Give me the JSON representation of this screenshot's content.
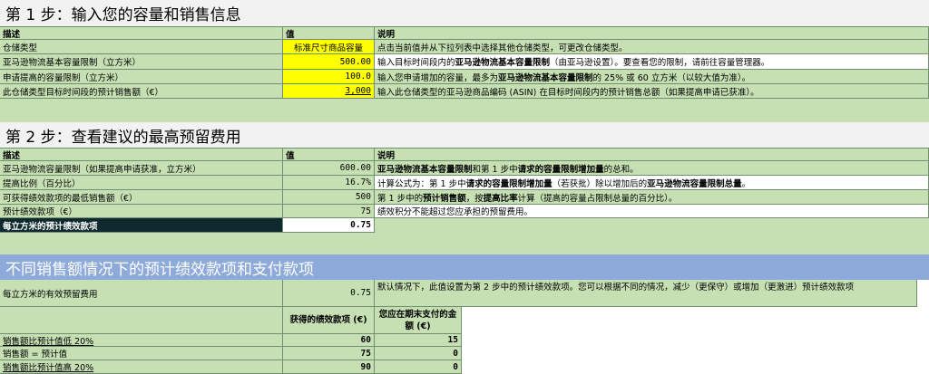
{
  "step1": {
    "title": "第 1 步：输入您的容量和销售信息",
    "headers": {
      "desc": "描述",
      "value": "值",
      "note": "说明"
    },
    "rows": [
      {
        "desc": "仓储类型",
        "value": "标准尺寸商品容量",
        "note": "点击当前值并从下拉列表中选择其他仓储类型，可更改仓储类型。"
      },
      {
        "desc": "亚马逊物流基本容量限制（立方米）",
        "value": "500.00",
        "note_pre": "输入目标时间段内的",
        "note_bold": "亚马逊物流基本容量限制",
        "note_post": "（由亚马逊设置）。要查看您的限制，请前往容量管理器。"
      },
      {
        "desc": "申请提高的容量限制（立方米）",
        "value": "100.0",
        "note_pre": "输入您申请增加的容量，最多为",
        "note_bold": "亚马逊物流基本容量限制",
        "note_post": "的 25% 或 60 立方米（以较大值为准）。"
      },
      {
        "desc": "此仓储类型目标时间段的预计销售额（€）",
        "value": "3,000",
        "note": "输入此仓储类型的亚马逊商品编码 (ASIN) 在目标时间段内的预计销售总额（如果提高申请已获准）。"
      }
    ]
  },
  "step2": {
    "title": "第 2 步：查看建议的最高预留费用",
    "headers": {
      "desc": "描述",
      "value": "值",
      "note": "说明"
    },
    "rows": [
      {
        "desc": "亚马逊物流容量限制（如果提高申请获准，立方米）",
        "value": "600.00",
        "note_b1": "亚马逊物流基本容量限制",
        "note_m1": "和第 1 步中",
        "note_b2": "请求的容量限制增加量",
        "note_m2": "的总和。"
      },
      {
        "desc": "提高比例（百分比）",
        "value": "16.7%",
        "note_m0": "计算公式为：第 1 步中",
        "note_b1": "请求的容量限制增加量",
        "note_m1": "（若获批）除以增加后的",
        "note_b2": "亚马逊物流容量限制总量",
        "note_m2": "。"
      },
      {
        "desc": "可获得绩效款项的最低销售额（€）",
        "value": "500",
        "note_m0": "第 1 步中的",
        "note_b1": "预计销售额",
        "note_m1": "，按",
        "note_b2": "提高比率",
        "note_m2": "计算（提高的容量占限制总量的百分比）。"
      },
      {
        "desc": "预计绩效款项（€）",
        "value": "75",
        "note": "绩效积分不能超过您应承担的预留费用。"
      },
      {
        "desc": "每立方米的预计绩效款项",
        "value": "0.75"
      }
    ]
  },
  "step3": {
    "title": "不同销售额情况下的预计绩效款项和支付款项",
    "effective": {
      "desc": "每立方米的有效预留费用",
      "value": "0.75",
      "note": "默认情况下，此值设置为第 2 步中的预计绩效款项。您可以根据不同的情况，减少（更保守）或增加（更激进）预计绩效款项"
    },
    "col_headers": {
      "payment": "获得的绩效款项 (€)",
      "pay": "您应在期末支付的金额 (€)"
    },
    "rows": [
      {
        "label": "销售额比预计值低 20%",
        "payment": "60",
        "pay": "15"
      },
      {
        "label": "销售额 = 预计值",
        "payment": "75",
        "pay": "0"
      },
      {
        "label": "销售额比预计值高 20%",
        "payment": "90",
        "pay": "0"
      }
    ]
  }
}
